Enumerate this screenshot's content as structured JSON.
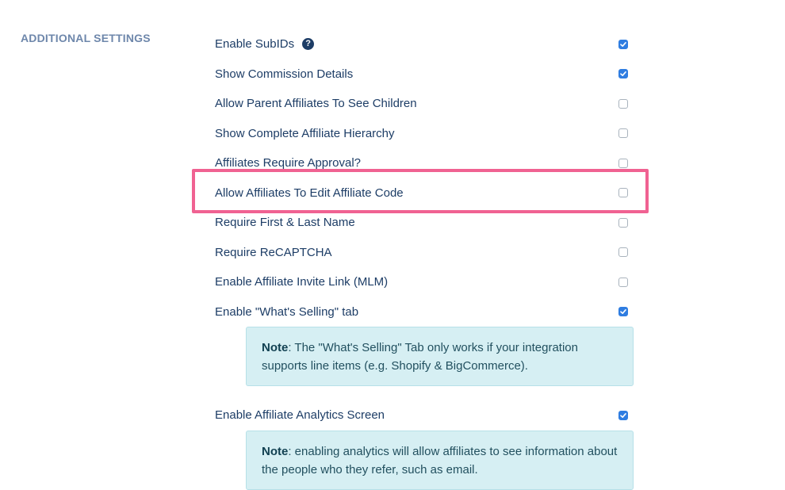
{
  "section": {
    "title": "ADDITIONAL SETTINGS"
  },
  "settings": [
    {
      "label": "Enable SubIDs",
      "checked": true,
      "help": true
    },
    {
      "label": "Show Commission Details",
      "checked": true
    },
    {
      "label": "Allow Parent Affiliates To See Children",
      "checked": false
    },
    {
      "label": "Show Complete Affiliate Hierarchy",
      "checked": false
    },
    {
      "label": "Affiliates Require Approval?",
      "checked": false
    },
    {
      "label": "Allow Affiliates To Edit Affiliate Code",
      "checked": false,
      "highlighted": true
    },
    {
      "label": "Require First & Last Name",
      "checked": false
    },
    {
      "label": "Require ReCAPTCHA",
      "checked": false
    },
    {
      "label": "Enable Affiliate Invite Link (MLM)",
      "checked": false
    },
    {
      "label": "Enable \"What's Selling\" tab",
      "checked": true
    },
    {
      "label": "Enable Affiliate Analytics Screen",
      "checked": true
    }
  ],
  "notes": {
    "whats_selling": {
      "strong": "Note",
      "text": ": The \"What's Selling\" Tab only works if your integration supports line items (e.g. Shopify & BigCommerce)."
    },
    "analytics": {
      "strong": "Note",
      "text": ": enabling analytics will allow affiliates to see information about the people who they refer, such as email."
    }
  },
  "icons": {
    "help": "question-circle-icon",
    "checkmark": "checkmark-icon"
  },
  "colors": {
    "section_title": "#6e87ab",
    "label": "#1d3d66",
    "checkbox_checked": "#2f7de1",
    "note_background": "#d6eff3",
    "highlight": "#f06292"
  }
}
